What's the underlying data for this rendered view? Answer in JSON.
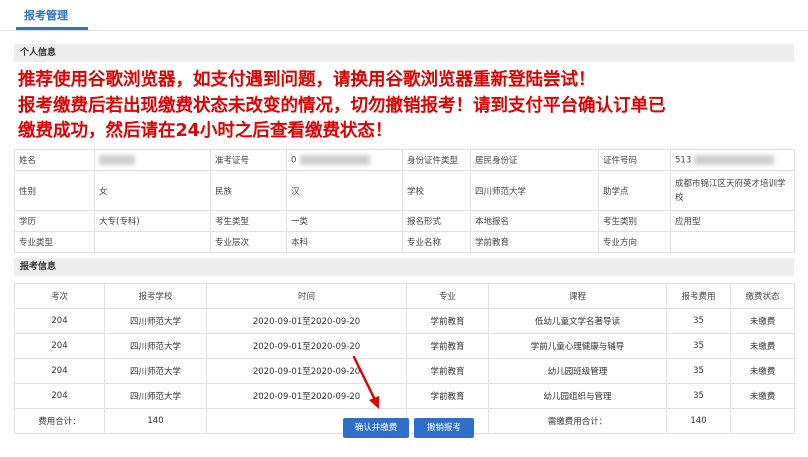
{
  "tab": {
    "label": "报考管理"
  },
  "personal": {
    "title": "个人信息",
    "notice": [
      "推荐使用谷歌浏览器，如支付遇到问题，请换用谷歌浏览器重新登陆尝试！",
      "报考缴费后若出现缴费状态未改变的情况，切勿撤销报考！请到支付平台确认订单已",
      "缴费成功，然后请在24小时之后查看缴费状态！"
    ],
    "rows": [
      [
        {
          "label": "姓名",
          "value": ""
        },
        {
          "label": "准考证号",
          "value": "0"
        },
        {
          "label": "身份证件类型",
          "value": "居民身份证"
        },
        {
          "label": "证件号码",
          "value": "513"
        }
      ],
      [
        {
          "label": "性别",
          "value": "女"
        },
        {
          "label": "民族",
          "value": "汉"
        },
        {
          "label": "学校",
          "value": "四川师范大学"
        },
        {
          "label": "助学点",
          "value": "成都市锦江区天府英才培训学校"
        }
      ],
      [
        {
          "label": "学历",
          "value": "大专(专科)"
        },
        {
          "label": "考生类型",
          "value": "一类"
        },
        {
          "label": "报名形式",
          "value": "本地报名"
        },
        {
          "label": "考生类别",
          "value": "应用型"
        }
      ],
      [
        {
          "label": "专业类型",
          "value": ""
        },
        {
          "label": "专业层次",
          "value": "本科"
        },
        {
          "label": "专业名称",
          "value": "学前教育"
        },
        {
          "label": "专业方向",
          "value": ""
        }
      ]
    ]
  },
  "registration": {
    "title": "报考信息",
    "columns": [
      "考次",
      "报考学校",
      "时间",
      "专业",
      "课程",
      "报考费用",
      "缴费状态"
    ],
    "rows": [
      [
        "204",
        "四川师范大学",
        "2020-09-01至2020-09-20",
        "学前教育",
        "低幼儿童文学名著导读",
        "35",
        "未缴费"
      ],
      [
        "204",
        "四川师范大学",
        "2020-09-01至2020-09-20",
        "学前教育",
        "学前儿童心理健康与辅导",
        "35",
        "未缴费"
      ],
      [
        "204",
        "四川师范大学",
        "2020-09-01至2020-09-20",
        "学前教育",
        "幼儿园班级管理",
        "35",
        "未缴费"
      ],
      [
        "204",
        "四川师范大学",
        "2020-09-01至2020-09-20",
        "学前教育",
        "幼儿园组织与管理",
        "35",
        "未缴费"
      ]
    ],
    "total_label": "费用合计：",
    "total_value": "140",
    "due_label": "需缴费用合计：",
    "due_value": "140"
  },
  "buttons": {
    "confirm_pay": "确认并缴费",
    "cancel_reg": "撤销报考"
  },
  "colors": {
    "accent": "#2f73c7",
    "notice": "#e00000",
    "arrow": "#e00000"
  }
}
